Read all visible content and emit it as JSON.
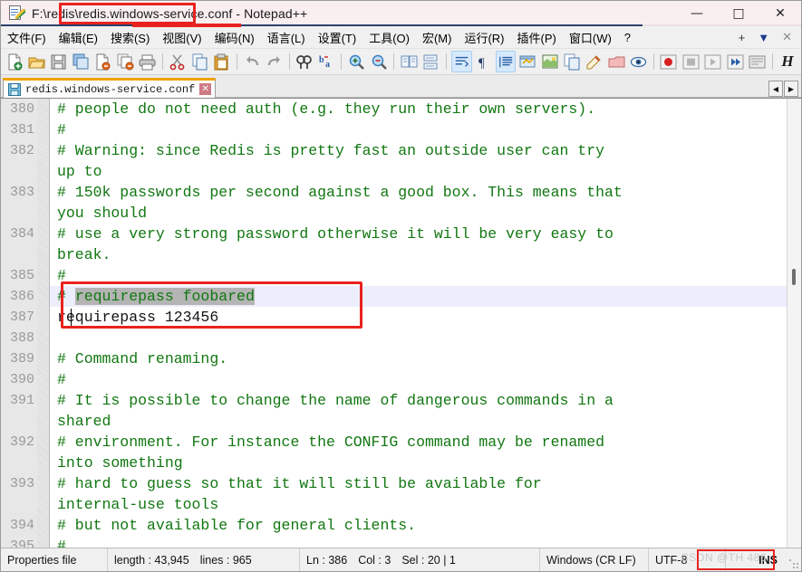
{
  "window": {
    "title": "F:\\redis\\redis.windows-service.conf - Notepad++",
    "icon": "notepad-plus-plus-icon",
    "controls": {
      "minimize": "—",
      "maximize": "□",
      "close": "✕"
    },
    "annotation_color": "#e8231f"
  },
  "menubar": {
    "items": [
      {
        "label": "文件(F)",
        "name": "menu-file"
      },
      {
        "label": "编辑(E)",
        "name": "menu-edit"
      },
      {
        "label": "搜索(S)",
        "name": "menu-search"
      },
      {
        "label": "视图(V)",
        "name": "menu-view"
      },
      {
        "label": "编码(N)",
        "name": "menu-encoding"
      },
      {
        "label": "语言(L)",
        "name": "menu-language"
      },
      {
        "label": "设置(T)",
        "name": "menu-settings"
      },
      {
        "label": "工具(O)",
        "name": "menu-tools"
      },
      {
        "label": "宏(M)",
        "name": "menu-macro"
      },
      {
        "label": "运行(R)",
        "name": "menu-run"
      },
      {
        "label": "插件(P)",
        "name": "menu-plugins"
      },
      {
        "label": "窗口(W)",
        "name": "menu-window"
      },
      {
        "label": "?",
        "name": "menu-help"
      }
    ],
    "right_controls": {
      "add": "+",
      "list": "▼",
      "close": "✕"
    }
  },
  "toolbar": {
    "buttons": [
      "new-file-icon",
      "open-file-icon",
      "save-icon",
      "save-all-icon",
      "close-file-icon",
      "close-all-icon",
      "print-icon",
      "sep",
      "cut-icon",
      "copy-icon",
      "paste-icon",
      "sep",
      "undo-icon",
      "redo-icon",
      "sep",
      "find-icon",
      "replace-icon",
      "sep",
      "zoom-in-icon",
      "zoom-out-icon",
      "sep",
      "sync-vertical-scroll-icon",
      "sync-horizontal-scroll-icon",
      "sep",
      "word-wrap-icon",
      "show-all-chars-icon",
      "indent-guide-icon",
      "ui-user-defined-dialog-icon",
      "document-map-icon",
      "function-list-icon",
      "folder-as-workspace-icon",
      "monitoring-icon",
      "sep",
      "record-macro-icon",
      "stop-recording-icon",
      "play-macro-icon",
      "run-macro-multiple-icon",
      "save-macro-icon",
      "sep",
      "html-tag-icon"
    ]
  },
  "tabbar": {
    "tabs": [
      {
        "label": "redis.windows-service.conf",
        "icon": "saved-file-icon",
        "close": "✕",
        "active": true
      }
    ],
    "scroll_left": "◀",
    "scroll_right": "▶"
  },
  "editor": {
    "first_line": 380,
    "line_numbers": [
      380,
      381,
      382,
      383,
      384,
      385,
      386,
      387,
      388,
      389,
      390,
      391,
      392,
      393,
      394,
      395
    ],
    "rows": [
      {
        "line": 380,
        "kind": "comment",
        "text": "# people do not need auth (e.g. they run their own servers)."
      },
      {
        "line": 381,
        "kind": "comment",
        "text": "#"
      },
      {
        "line": 382,
        "kind": "comment",
        "text": "# Warning: since Redis is pretty fast an outside user can try"
      },
      {
        "line": null,
        "kind": "comment",
        "text": "up to"
      },
      {
        "line": 383,
        "kind": "comment",
        "text": "# 150k passwords per second against a good box. This means that"
      },
      {
        "line": null,
        "kind": "comment",
        "text": "you should"
      },
      {
        "line": 384,
        "kind": "comment",
        "text": "# use a very strong password otherwise it will be very easy to"
      },
      {
        "line": null,
        "kind": "comment",
        "text": "break."
      },
      {
        "line": 385,
        "kind": "comment",
        "text": "#"
      },
      {
        "line": 386,
        "kind": "comment-selected",
        "prefix": "# ",
        "selected": "requirepass foobared",
        "text": "# requirepass foobared"
      },
      {
        "line": 387,
        "kind": "plain",
        "text": "requirepass 123456"
      },
      {
        "line": 388,
        "kind": "blank",
        "text": ""
      },
      {
        "line": 389,
        "kind": "comment",
        "text": "# Command renaming."
      },
      {
        "line": 390,
        "kind": "comment",
        "text": "#"
      },
      {
        "line": 391,
        "kind": "comment",
        "text": "# It is possible to change the name of dangerous commands in a"
      },
      {
        "line": null,
        "kind": "comment",
        "text": "shared"
      },
      {
        "line": 392,
        "kind": "comment",
        "text": "# environment. For instance the CONFIG command may be renamed"
      },
      {
        "line": null,
        "kind": "comment",
        "text": "into something"
      },
      {
        "line": 393,
        "kind": "comment",
        "text": "# hard to guess so that it will still be available for"
      },
      {
        "line": null,
        "kind": "comment",
        "text": "internal-use tools"
      },
      {
        "line": 394,
        "kind": "comment",
        "text": "# but not available for general clients."
      },
      {
        "line": 395,
        "kind": "comment",
        "text": "#"
      }
    ],
    "comment_color": "#117711",
    "text_color": "#141414",
    "current_line_color": "#edeefb",
    "selection_color": "#b4b4b4"
  },
  "statusbar": {
    "language": "Properties file",
    "length": "length : 43,945",
    "lines": "lines : 965",
    "ln": "Ln : 386",
    "col": "Col : 3",
    "sel": "Sel : 20 | 1",
    "eol": "Windows (CR LF)",
    "encoding": "UTF-8",
    "insert_mode": "INS",
    "watermark": "CSDN @TH 486"
  }
}
